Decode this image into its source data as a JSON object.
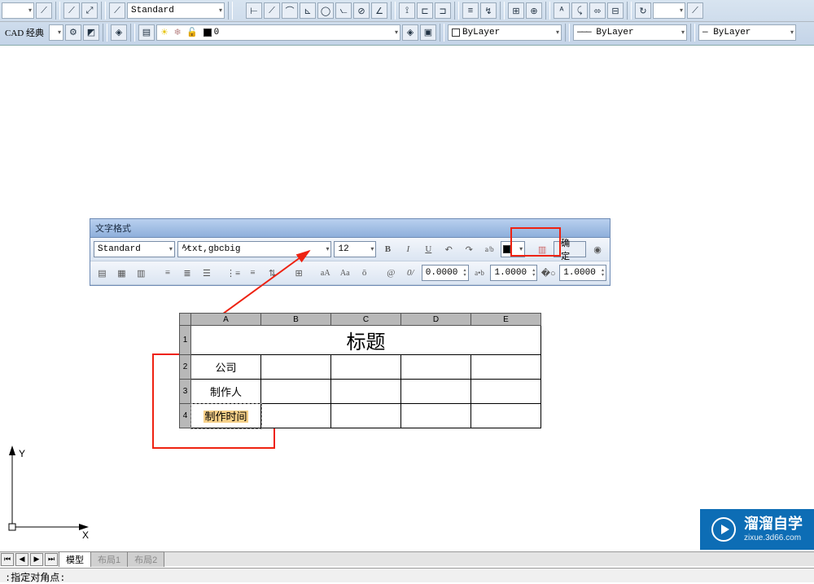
{
  "top": {
    "style_dropdown": "Standard",
    "workspace": "CAD 经典",
    "layer_value": "0",
    "color_label": "ByLayer",
    "linetype_label": "ByLayer",
    "lineweight_label": "ByLayer"
  },
  "text_panel": {
    "title": "文字格式",
    "style": "Standard",
    "font": "txt,gbcbig",
    "size": "12",
    "ok": "确定",
    "spin1": "0.0000",
    "spin2": "1.0000",
    "spin3": "1.0000"
  },
  "table": {
    "cols": [
      "A",
      "B",
      "C",
      "D",
      "E"
    ],
    "rows": [
      "1",
      "2",
      "3",
      "4"
    ],
    "title": "标题",
    "r2": "公司",
    "r3": "制作人",
    "r4": "制作时间"
  },
  "ucs": {
    "x": "X",
    "y": "Y"
  },
  "tabs": {
    "model": "模型",
    "layout1": "布局1",
    "layout2": "布局2"
  },
  "cmd": {
    "text": ":指定对角点:"
  },
  "watermark": {
    "big": "溜溜自学",
    "sm": "zixue.3d66.com"
  }
}
